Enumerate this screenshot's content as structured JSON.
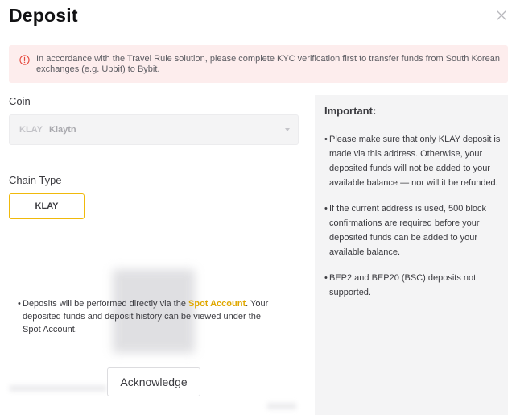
{
  "dialog": {
    "title": "Deposit"
  },
  "alert": {
    "text": "In accordance with the Travel Rule solution, please complete KYC verification first to transfer funds from South Korean exchanges (e.g. Upbit) to Bybit."
  },
  "coin": {
    "label": "Coin",
    "symbol": "KLAY",
    "name": "Klaytn"
  },
  "chain": {
    "label": "Chain Type",
    "selected": "KLAY"
  },
  "notice": {
    "bullet": "•",
    "text_before": "Deposits will be performed directly via the ",
    "link": "Spot Account",
    "text_after": ". Your deposited funds and deposit history can be viewed under the Spot Account.",
    "button": "Acknowledge"
  },
  "important": {
    "heading": "Important:",
    "items": [
      {
        "bullet": "•",
        "text": "Please make sure that only KLAY deposit is made via this address. Otherwise, your deposited funds will not be added to your available balance — nor will it be refunded."
      },
      {
        "bullet": "•",
        "text": "If the current address is used, 500 block confirmations are required before your deposited funds can be added to your available balance."
      },
      {
        "bullet": "•",
        "text": "BEP2 and BEP20 (BSC) deposits not supported."
      }
    ]
  },
  "colors": {
    "accent": "#f0b90b",
    "alert_bg": "#fdeded",
    "alert_icon": "#e5483d",
    "panel_bg": "#f4f4f5"
  },
  "icons": {
    "close": "close-icon",
    "alert": "alert-circle-icon",
    "dropdown": "caret-down-icon"
  }
}
